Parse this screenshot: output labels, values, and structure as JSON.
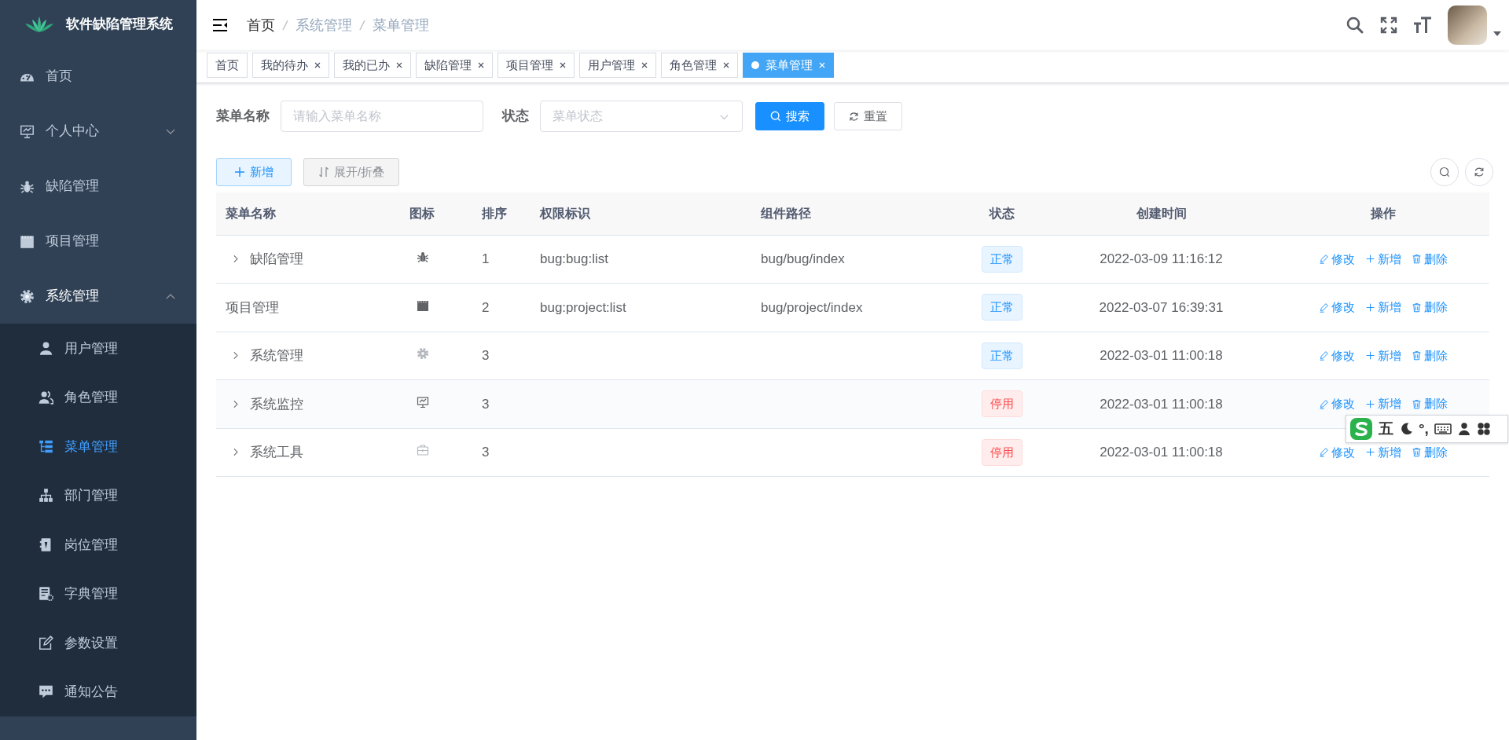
{
  "sidebar": {
    "title": "软件缺陷管理系统",
    "items": [
      {
        "label": "首页",
        "selected": false
      },
      {
        "label": "个人中心",
        "selected": false,
        "expanded": false
      },
      {
        "label": "缺陷管理",
        "selected": false
      },
      {
        "label": "项目管理",
        "selected": false
      },
      {
        "label": "系统管理",
        "selected": false,
        "expanded": true,
        "children": [
          {
            "label": "用户管理",
            "selected": false
          },
          {
            "label": "角色管理",
            "selected": false
          },
          {
            "label": "菜单管理",
            "selected": true
          },
          {
            "label": "部门管理",
            "selected": false
          },
          {
            "label": "岗位管理",
            "selected": false
          },
          {
            "label": "字典管理",
            "selected": false
          },
          {
            "label": "参数设置",
            "selected": false
          },
          {
            "label": "通知公告",
            "selected": false
          }
        ]
      }
    ]
  },
  "breadcrumb": [
    "首页",
    "系统管理",
    "菜单管理"
  ],
  "tabs": [
    {
      "label": "首页",
      "selected": false,
      "closable": false
    },
    {
      "label": "我的待办",
      "selected": false,
      "closable": true
    },
    {
      "label": "我的已办",
      "selected": false,
      "closable": true
    },
    {
      "label": "缺陷管理",
      "selected": false,
      "closable": true
    },
    {
      "label": "项目管理",
      "selected": false,
      "closable": true
    },
    {
      "label": "用户管理",
      "selected": false,
      "closable": true
    },
    {
      "label": "角色管理",
      "selected": false,
      "closable": true
    },
    {
      "label": "菜单管理",
      "selected": true,
      "closable": true
    }
  ],
  "search_form": {
    "fields": [
      {
        "kind": "input",
        "label": "菜单名称",
        "placeholder": "请输入菜单名称"
      },
      {
        "kind": "select",
        "label": "状态",
        "placeholder": "菜单状态"
      }
    ],
    "search_button": "搜索",
    "reset_button": "重置"
  },
  "toolbar": {
    "add_button": "新增",
    "toggle_button": "展开/折叠"
  },
  "table": {
    "columns": [
      "菜单名称",
      "图标",
      "排序",
      "权限标识",
      "组件路径",
      "状态",
      "创建时间",
      "操作"
    ],
    "rows": [
      {
        "name": "缺陷管理",
        "has_children": true,
        "highlighted": false,
        "order": "1",
        "perms": "bug:bug:list",
        "component": "bug/bug/index",
        "status": {
          "kind": "primary",
          "label": "正常"
        },
        "created": "2022-03-09 11:16:12",
        "actions": [
          {
            "kind": "edit",
            "label": "修改"
          },
          {
            "kind": "add",
            "label": "新增"
          },
          {
            "kind": "delete",
            "label": "删除"
          }
        ]
      },
      {
        "name": "项目管理",
        "has_children": false,
        "highlighted": false,
        "order": "2",
        "perms": "bug:project:list",
        "component": "bug/project/index",
        "status": {
          "kind": "primary",
          "label": "正常"
        },
        "created": "2022-03-07 16:39:31",
        "actions": [
          {
            "kind": "edit",
            "label": "修改"
          },
          {
            "kind": "add",
            "label": "新增"
          },
          {
            "kind": "delete",
            "label": "删除"
          }
        ]
      },
      {
        "name": "系统管理",
        "has_children": true,
        "highlighted": false,
        "order": "3",
        "status": {
          "kind": "primary",
          "label": "正常"
        },
        "created": "2022-03-01 11:00:18",
        "actions": [
          {
            "kind": "edit",
            "label": "修改"
          },
          {
            "kind": "add",
            "label": "新增"
          },
          {
            "kind": "delete",
            "label": "删除"
          }
        ]
      },
      {
        "name": "系统监控",
        "has_children": true,
        "highlighted": true,
        "order": "3",
        "status": {
          "kind": "danger",
          "label": "停用"
        },
        "created": "2022-03-01 11:00:18",
        "actions": [
          {
            "kind": "edit",
            "label": "修改"
          },
          {
            "kind": "add",
            "label": "新增"
          },
          {
            "kind": "delete",
            "label": "删除"
          }
        ]
      },
      {
        "name": "系统工具",
        "has_children": true,
        "highlighted": false,
        "order": "3",
        "status": {
          "kind": "danger",
          "label": "停用"
        },
        "created": "2022-03-01 11:00:18",
        "actions": [
          {
            "kind": "edit",
            "label": "修改"
          },
          {
            "kind": "add",
            "label": "新增"
          },
          {
            "kind": "delete",
            "label": "删除"
          }
        ]
      }
    ]
  },
  "ime_toolbar": {
    "mode": "五",
    "punctuation": "°,"
  }
}
